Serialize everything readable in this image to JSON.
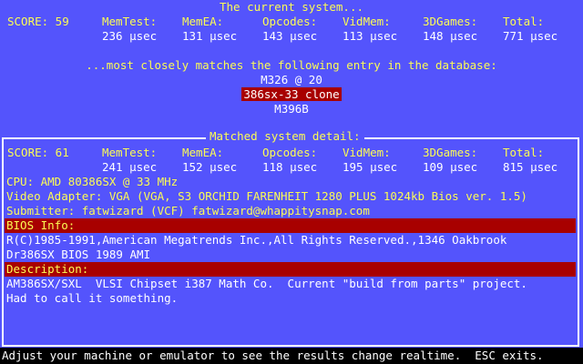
{
  "current": {
    "title": "The current system...",
    "headers": {
      "score": "SCORE: 59",
      "memtest": "MemTest:",
      "memea": "MemEA:",
      "opcodes": "Opcodes:",
      "vidmem": "VidMem:",
      "games3d": "3DGames:",
      "total": "Total:"
    },
    "values": {
      "memtest": "236 μsec",
      "memea": "131 μsec",
      "opcodes": "143 μsec",
      "vidmem": "113 μsec",
      "games3d": "148 μsec",
      "total": "771 μsec"
    }
  },
  "match": {
    "heading": "...most closely matches the following entry in the database:",
    "prev_entry": "M326 @ 20",
    "selected_entry": "386sx-33 clone",
    "next_entry": "M396B"
  },
  "detail": {
    "title": "Matched system detail:",
    "headers": {
      "score": "SCORE: 61",
      "memtest": "MemTest:",
      "memea": "MemEA:",
      "opcodes": "Opcodes:",
      "vidmem": "VidMem:",
      "games3d": "3DGames:",
      "total": "Total:"
    },
    "values": {
      "memtest": "241 μsec",
      "memea": "152 μsec",
      "opcodes": "118 μsec",
      "vidmem": "195 μsec",
      "games3d": "109 μsec",
      "total": "815 μsec"
    },
    "cpu": "CPU: AMD 80386SX @ 33 MHz",
    "video": "Video Adapter: VGA (VGA, S3 ORCHID FARENHEIT 1280 PLUS 1024kb Bios ver. 1.5)",
    "submitter": "Submitter: fatwizard (VCF) fatwizard@whappitysnap.com",
    "bios_label": "BIOS Info:",
    "bios_lines": [
      "R(C)1985-1991,American Megatrends Inc.,All Rights Reserved.,1346 Oakbrook",
      "Dr386SX BIOS 1989 AMI"
    ],
    "desc_label": "Description:",
    "desc_lines": [
      "AM386SX/SXL  VLSI Chipset i387 Math Co.  Current \"build from parts\" project.",
      "Had to call it something."
    ]
  },
  "status": "Adjust your machine or emulator to see the results change realtime.  ESC exits."
}
